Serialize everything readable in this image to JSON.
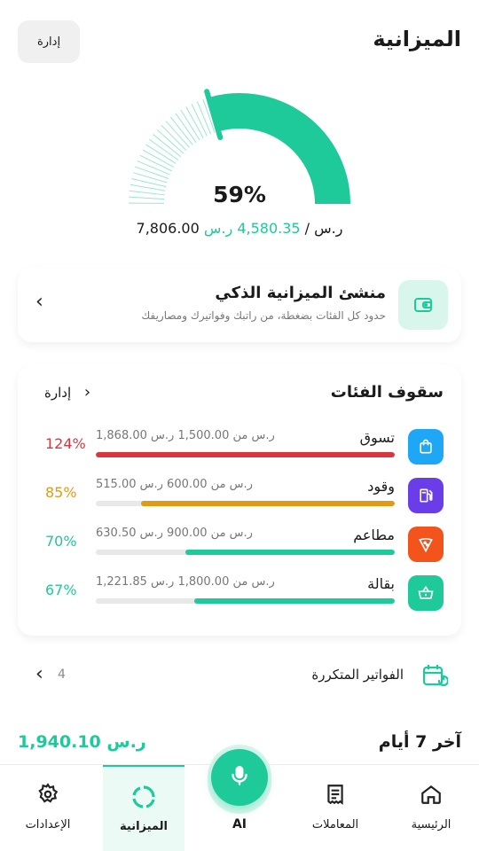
{
  "header": {
    "title": "الميزانية",
    "manage_label": "إدارة"
  },
  "gauge": {
    "percent_label": "59%",
    "percent_value": 59,
    "spent": "4,580.35 ر.س",
    "separator": " / ",
    "total": "7,806.00 ر.س",
    "color": "#1ec99a"
  },
  "smart_builder": {
    "title": "منشئ الميزانية الذكي",
    "subtitle": "حدود كل الفئات بضغطة، من راتبك وفواتيرك ومصاريفك",
    "icon": "wallet-icon"
  },
  "categories": {
    "title": "سقوف الفئات",
    "manage_label": "إدارة",
    "items": [
      {
        "name": "تسوق",
        "amount": "1,868.00 ر.س من 1,500.00 ر.س",
        "percent": "124%",
        "fill": 1.0,
        "color": "#d9363e",
        "icon": "shopping-bag-icon",
        "icon_bg": "#1ea7f5"
      },
      {
        "name": "وقود",
        "amount": "515.00 ر.س من 600.00 ر.س",
        "percent": "85%",
        "fill": 0.85,
        "color": "#e29a12",
        "icon": "fuel-icon",
        "icon_bg": "#6a3de8"
      },
      {
        "name": "مطاعم",
        "amount": "630.50 ر.س من 900.00 ر.س",
        "percent": "70%",
        "fill": 0.7,
        "color": "#1ec99a",
        "icon": "pizza-icon",
        "icon_bg": "#f2541b"
      },
      {
        "name": "بقالة",
        "amount": "1,221.85 ر.س من 1,800.00 ر.س",
        "percent": "67%",
        "fill": 0.67,
        "color": "#1ec99a",
        "icon": "basket-icon",
        "icon_bg": "#1ec99a"
      }
    ]
  },
  "recurring": {
    "label": "الفواتير المتكررة",
    "count": "4",
    "icon": "calendar-repeat-icon"
  },
  "last7": {
    "title": "آخر 7 أيام",
    "amount": "1,940.10 ر.س"
  },
  "nav": {
    "home": "الرئيسية",
    "transactions": "المعاملات",
    "ai": "AI",
    "budget": "الميزانية",
    "settings": "الإعدادات"
  }
}
